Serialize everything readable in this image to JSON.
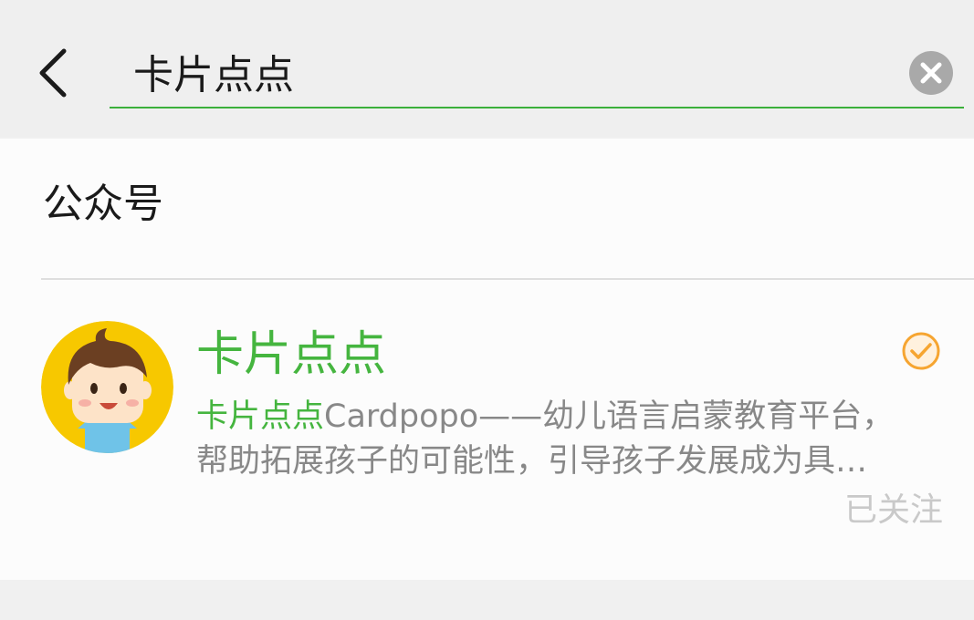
{
  "search": {
    "value": "卡片点点"
  },
  "section": {
    "title": "公众号"
  },
  "result": {
    "name": "卡片点点",
    "desc_highlight": "卡片点点",
    "desc_line1_rest": "Cardpopo——幼儿语言启蒙教育平台，",
    "desc_line2": "帮助拓展孩子的可能性，引导孩子发展成为具…",
    "status": "已关注"
  },
  "colors": {
    "accent_green": "#45b53f",
    "underline_green": "#3bb03b",
    "verified_orange": "#f6a531",
    "avatar_yellow": "#f7c800"
  },
  "icons": {
    "back": "chevron-left-icon",
    "clear": "close-circle-icon",
    "verified": "check-circle-icon"
  }
}
